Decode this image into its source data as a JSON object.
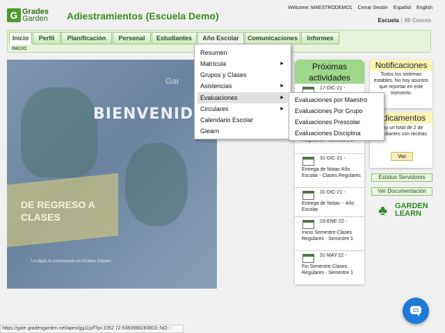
{
  "header": {
    "logo_line1": "Grades",
    "logo_line2": "Garden",
    "title": "Adiestramientos (Escuela Demo)",
    "welcome": "Welcome: MAESTRODEMO1",
    "logout": "Cerrar Sesión",
    "lang_es": "Español",
    "lang_en": "English",
    "switch_active": "Escuela",
    "switch_inactive": "Mi Cuenta"
  },
  "nav": {
    "tabs": [
      "Inicio",
      "Perfil",
      "Planificación",
      "Personal",
      "Estudiantes",
      "Año Escolar",
      "Comunicaciones",
      "Informes"
    ],
    "breadcrumb": "INICIO"
  },
  "banner": {
    "title": "BIENVENIDOS",
    "subtitle": "DE REGRESO A CLASES",
    "footer": "Lo dejas tu comunicado en Grades Garden",
    "logo": "Gar"
  },
  "activities": {
    "title": "Próximas actividades",
    "items": [
      {
        "date": "17-DIC-21 -",
        "desc": ""
      },
      {
        "date": "",
        "desc": "Regulares - Semestre 2"
      },
      {
        "date": "31-DIC-21 -",
        "desc": "Entrega de Notas-Año Escolar - Clases Regulares"
      },
      {
        "date": "31-DIC-21 -",
        "desc": "Entrega de Notas- - Año Escolar"
      },
      {
        "date": "03-ENE-22 -",
        "desc": "Inicio Semestre-Clases Regulares - Semestre 1"
      },
      {
        "date": "31-MAY-22 -",
        "desc": "Fin Semestre-Clases Regulares - Semestre 1"
      }
    ]
  },
  "notifications": {
    "title": "Notificaciones",
    "body": "Todos los sistemas estables. No hay asuntos que reportar en este momento."
  },
  "medications": {
    "title": "Medicamentos",
    "body": "Hay un total de 2 de estudiantes con recetas",
    "button": "Ver"
  },
  "side_buttons": {
    "status": "Estatus Servidores",
    "docs": "Ver Documentación"
  },
  "garden_learn": {
    "line1": "GARDEN",
    "line2": "LEARN"
  },
  "menu": {
    "items": [
      "Resumen",
      "Matrícula",
      "Grupos y Clases",
      "Asistencias",
      "Evaluaciones",
      "Circulares",
      "Calendario Escolar",
      "Glearn"
    ],
    "submenu": [
      "Evaluaciones por Maestro",
      "Evaluaciones Por Grupo",
      "Evaluaciones Prescolar",
      "Evaluaciones Disciplina"
    ]
  },
  "status_url": "https://gate.gradesgarden.net/apex/gg11p/f?p=1052:72:9383988283803::NO:::"
}
